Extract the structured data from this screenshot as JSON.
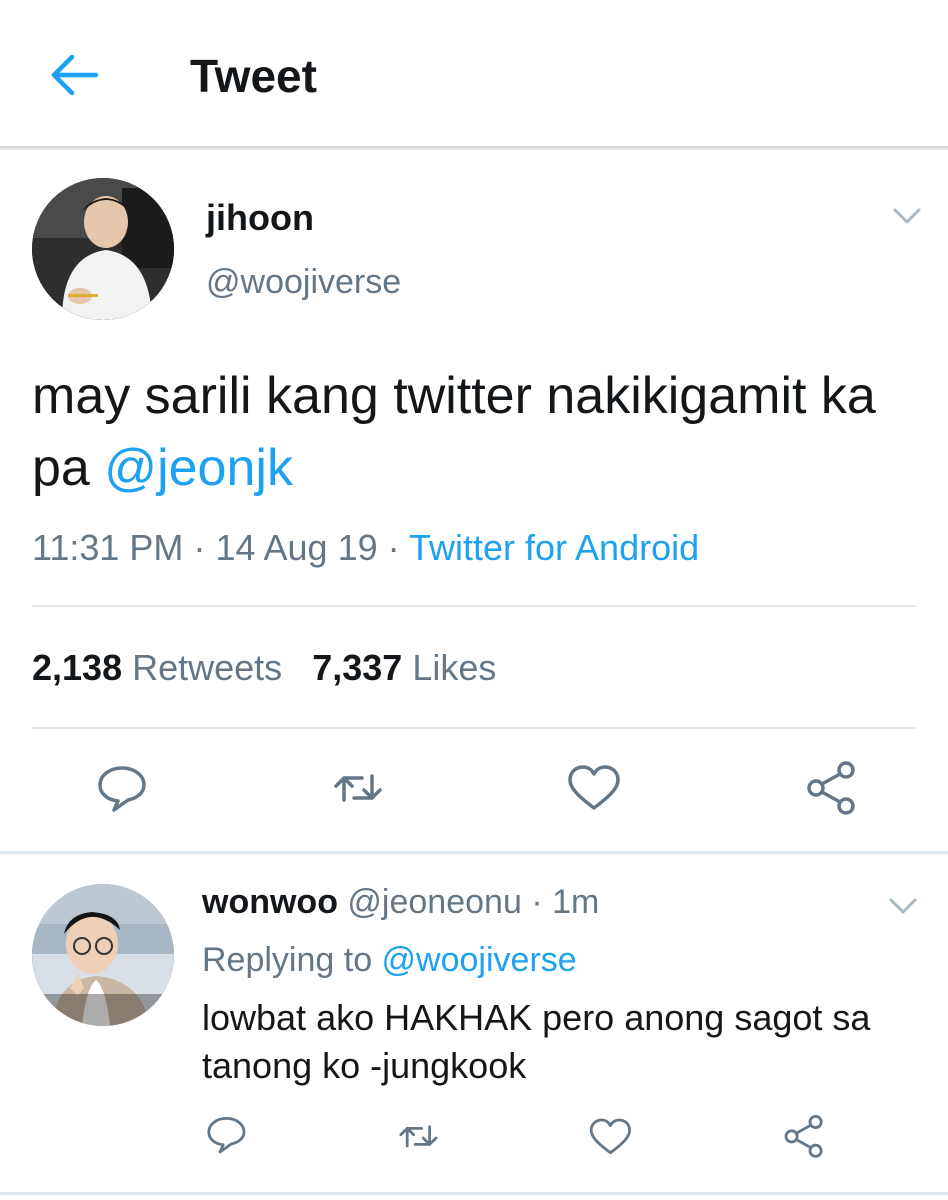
{
  "header": {
    "title": "Tweet",
    "back_icon": "arrow-left-icon",
    "accent": "#1da1f2"
  },
  "tweet": {
    "display_name": "jihoon",
    "handle": "@woojiverse",
    "text": "may sarili kang twitter nakikigamit ka pa ",
    "mention": "@jeonjk",
    "time": "11:31 PM",
    "separator": "·",
    "date": "14 Aug 19",
    "source": "Twitter for Android",
    "retweets_count": "2,138",
    "retweets_label": "Retweets",
    "likes_count": "7,337",
    "likes_label": "Likes",
    "actions": [
      "reply-icon",
      "retweet-icon",
      "like-icon",
      "share-icon"
    ]
  },
  "reply": {
    "display_name": "wonwoo",
    "handle": "@jeoneonu",
    "separator": "·",
    "age": "1m",
    "replying_prefix": "Replying to ",
    "replying_handle": "@woojiverse",
    "text": "lowbat ako HAKHAK pero anong sagot sa tanong ko -jungkook",
    "actions": [
      "reply-icon",
      "retweet-icon",
      "like-icon",
      "share-icon"
    ]
  }
}
